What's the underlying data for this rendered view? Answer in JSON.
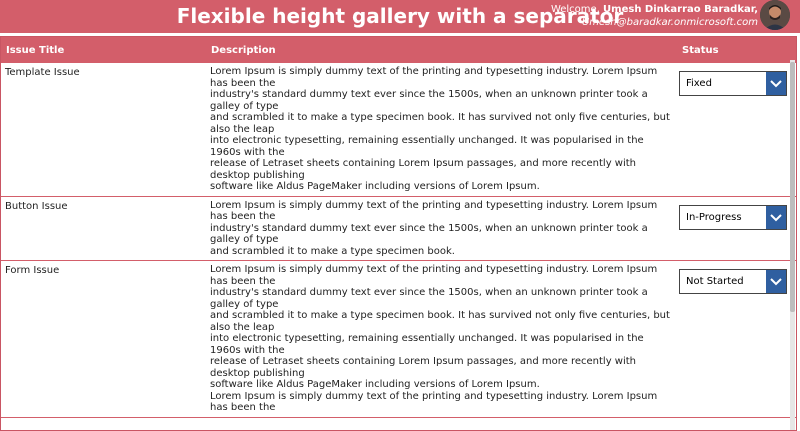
{
  "app": {
    "title": "Flexible height gallery with a separator",
    "welcome_prefix": "Welcome, ",
    "user_name": "Umesh Dinkarrao Baradkar,",
    "user_email": "Umesh@baradkar.onmicrosoft.com"
  },
  "table": {
    "headers": {
      "title": "Issue Title",
      "description": "Description",
      "status": "Status"
    },
    "rows": [
      {
        "title": "Template Issue",
        "status": "Fixed",
        "lines": [
          "Lorem Ipsum is simply dummy text of the printing and typesetting industry. Lorem Ipsum has been the",
          "industry's standard dummy text ever since the 1500s, when an unknown printer took a galley of type",
          "and scrambled it to make a type specimen book. It has survived not only five centuries, but also the leap",
          "into electronic typesetting, remaining essentially unchanged. It was popularised in the 1960s with the",
          "release of Letraset sheets containing Lorem Ipsum passages, and more recently with desktop publishing",
          "software like Aldus PageMaker including versions of Lorem Ipsum."
        ]
      },
      {
        "title": "Button Issue",
        "status": "In-Progress",
        "lines": [
          "Lorem Ipsum is simply dummy text of the printing and typesetting industry. Lorem Ipsum has been the",
          "industry's standard dummy text ever since the 1500s, when an unknown printer took a galley of type",
          "and scrambled it to make a type specimen book."
        ]
      },
      {
        "title": "Form Issue",
        "status": "Not Started",
        "lines": [
          "Lorem Ipsum is simply dummy text of the printing and typesetting industry. Lorem Ipsum has been the",
          "industry's standard dummy text ever since the 1500s, when an unknown printer took a galley of type",
          "and scrambled it to make a type specimen book. It has survived not only five centuries, but also the leap",
          "into electronic typesetting, remaining essentially unchanged. It was popularised in the 1960s with the",
          "release of Letraset sheets containing Lorem Ipsum passages, and more recently with desktop publishing",
          "software like Aldus PageMaker including versions of Lorem Ipsum.",
          "Lorem Ipsum is simply dummy text of the printing and typesetting industry. Lorem Ipsum has been the"
        ]
      }
    ]
  },
  "colors": {
    "accent": "#d35e6a",
    "dropdown_button": "#2f5fa0"
  },
  "icons": {
    "dropdown": "chevron-down-icon",
    "avatar": "user-avatar"
  }
}
